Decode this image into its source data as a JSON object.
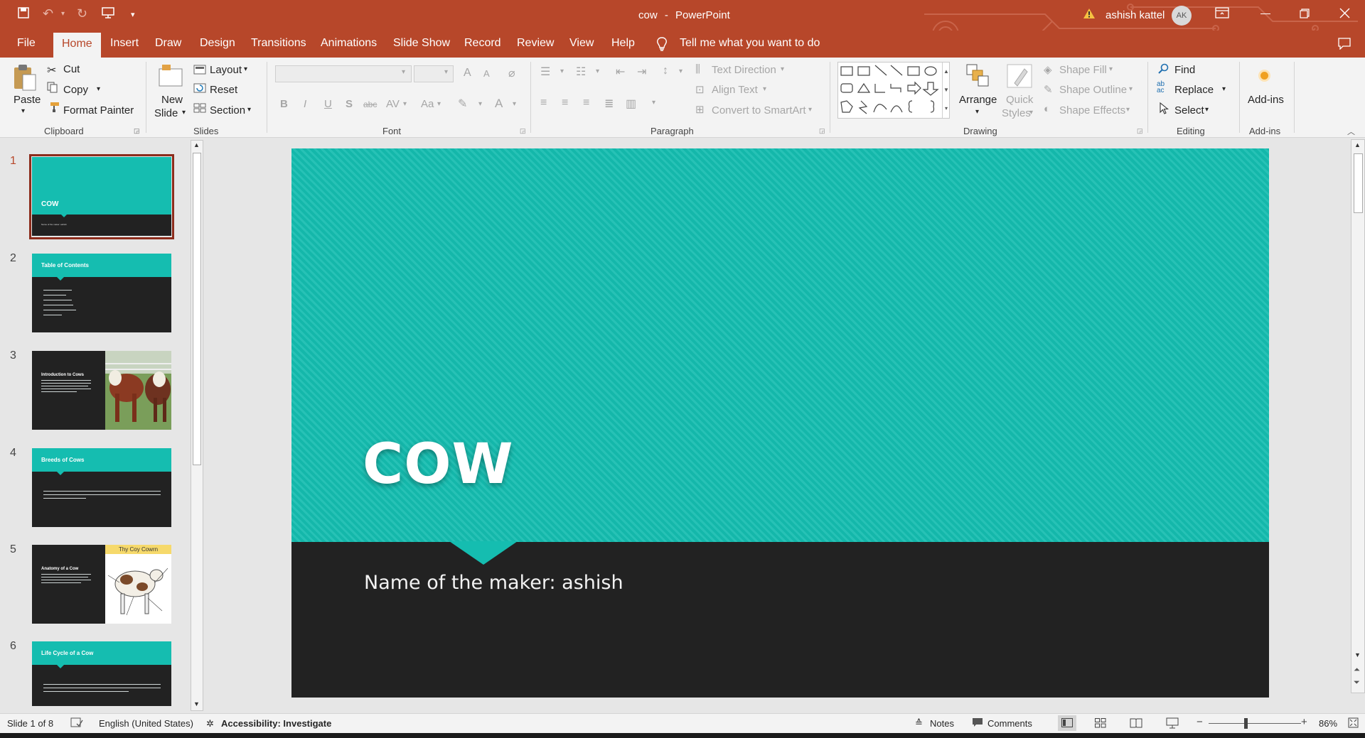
{
  "titlebar": {
    "doc_title": "cow",
    "separator": "-",
    "app_name": "PowerPoint",
    "user_name": "ashish kattel",
    "user_initials": "AK",
    "warning_icon": "warning-icon"
  },
  "tabs": [
    "File",
    "Home",
    "Insert",
    "Draw",
    "Design",
    "Transitions",
    "Animations",
    "Slide Show",
    "Record",
    "Review",
    "View",
    "Help"
  ],
  "tell_me": "Tell me what you want to do",
  "ribbon": {
    "clipboard": {
      "label": "Clipboard",
      "paste": "Paste",
      "cut": "Cut",
      "copy": "Copy",
      "format_painter": "Format Painter"
    },
    "slides": {
      "label": "Slides",
      "new_slide_line1": "New",
      "new_slide_line2": "Slide",
      "layout": "Layout",
      "reset": "Reset",
      "section": "Section"
    },
    "font": {
      "label": "Font",
      "bold": "B",
      "italic": "I",
      "underline": "U",
      "shadow": "S",
      "strike": "abc",
      "spacing": "AV",
      "case": "Aa",
      "grow": "A",
      "shrink": "A"
    },
    "paragraph": {
      "label": "Paragraph",
      "text_direction": "Text Direction",
      "align_text": "Align Text",
      "convert_smartart": "Convert to SmartArt"
    },
    "drawing": {
      "label": "Drawing",
      "arrange": "Arrange",
      "quick_styles_line1": "Quick",
      "quick_styles_line2": "Styles",
      "shape_fill": "Shape Fill",
      "shape_outline": "Shape Outline",
      "shape_effects": "Shape Effects"
    },
    "editing": {
      "label": "Editing",
      "find": "Find",
      "replace": "Replace",
      "select": "Select"
    },
    "addins": {
      "label": "Add-ins",
      "addins_btn": "Add-ins"
    }
  },
  "thumbnails": [
    {
      "num": "1",
      "title": "COW",
      "sub": "Name of the maker: ashish"
    },
    {
      "num": "2",
      "title": "Table of Contents"
    },
    {
      "num": "3",
      "title": "Introduction to Cows"
    },
    {
      "num": "4",
      "title": "Breeds of Cows"
    },
    {
      "num": "5",
      "title": "Anatomy of a Cow",
      "image_caption": "Thy Coy Cowrn"
    },
    {
      "num": "6",
      "title": "Life Cycle of a Cow"
    }
  ],
  "slide": {
    "title": "COW",
    "subtitle": "Name of the maker: ashish",
    "colors": {
      "teal": "#15bdb0",
      "dark": "#222222"
    }
  },
  "status": {
    "slide_info": "Slide 1 of 8",
    "language": "English (United States)",
    "accessibility": "Accessibility: Investigate",
    "notes": "Notes",
    "comments": "Comments",
    "zoom": "86%"
  },
  "colors": {
    "accent": "#b7472a",
    "ribbon_bg": "#f3f3f3"
  }
}
